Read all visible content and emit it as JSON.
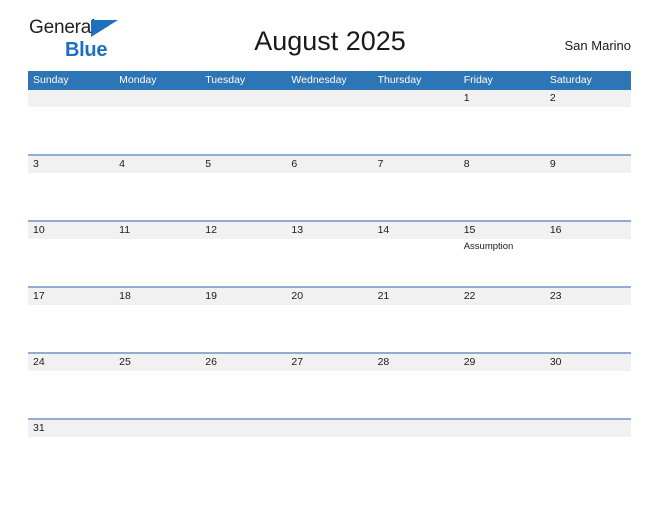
{
  "brand": {
    "line1": "General",
    "line2": "Blue",
    "triangle_color": "#1f6fc0"
  },
  "header": {
    "title": "August 2025",
    "locale": "San Marino"
  },
  "colors": {
    "header_blue": "#2e75b6",
    "row_line_blue": "#8eadd0",
    "date_band_gray": "#f1f1f1",
    "text": "#1a1a1a"
  },
  "calendar": {
    "weekdays": [
      "Sunday",
      "Monday",
      "Tuesday",
      "Wednesday",
      "Thursday",
      "Friday",
      "Saturday"
    ],
    "weeks": [
      {
        "days": [
          {
            "date": "",
            "event": ""
          },
          {
            "date": "",
            "event": ""
          },
          {
            "date": "",
            "event": ""
          },
          {
            "date": "",
            "event": ""
          },
          {
            "date": "",
            "event": ""
          },
          {
            "date": "1",
            "event": ""
          },
          {
            "date": "2",
            "event": ""
          }
        ]
      },
      {
        "days": [
          {
            "date": "3",
            "event": ""
          },
          {
            "date": "4",
            "event": ""
          },
          {
            "date": "5",
            "event": ""
          },
          {
            "date": "6",
            "event": ""
          },
          {
            "date": "7",
            "event": ""
          },
          {
            "date": "8",
            "event": ""
          },
          {
            "date": "9",
            "event": ""
          }
        ]
      },
      {
        "days": [
          {
            "date": "10",
            "event": ""
          },
          {
            "date": "11",
            "event": ""
          },
          {
            "date": "12",
            "event": ""
          },
          {
            "date": "13",
            "event": ""
          },
          {
            "date": "14",
            "event": ""
          },
          {
            "date": "15",
            "event": "Assumption"
          },
          {
            "date": "16",
            "event": ""
          }
        ]
      },
      {
        "days": [
          {
            "date": "17",
            "event": ""
          },
          {
            "date": "18",
            "event": ""
          },
          {
            "date": "19",
            "event": ""
          },
          {
            "date": "20",
            "event": ""
          },
          {
            "date": "21",
            "event": ""
          },
          {
            "date": "22",
            "event": ""
          },
          {
            "date": "23",
            "event": ""
          }
        ]
      },
      {
        "days": [
          {
            "date": "24",
            "event": ""
          },
          {
            "date": "25",
            "event": ""
          },
          {
            "date": "26",
            "event": ""
          },
          {
            "date": "27",
            "event": ""
          },
          {
            "date": "28",
            "event": ""
          },
          {
            "date": "29",
            "event": ""
          },
          {
            "date": "30",
            "event": ""
          }
        ]
      },
      {
        "days": [
          {
            "date": "31",
            "event": ""
          },
          {
            "date": "",
            "event": ""
          },
          {
            "date": "",
            "event": ""
          },
          {
            "date": "",
            "event": ""
          },
          {
            "date": "",
            "event": ""
          },
          {
            "date": "",
            "event": ""
          },
          {
            "date": "",
            "event": ""
          }
        ]
      }
    ]
  }
}
